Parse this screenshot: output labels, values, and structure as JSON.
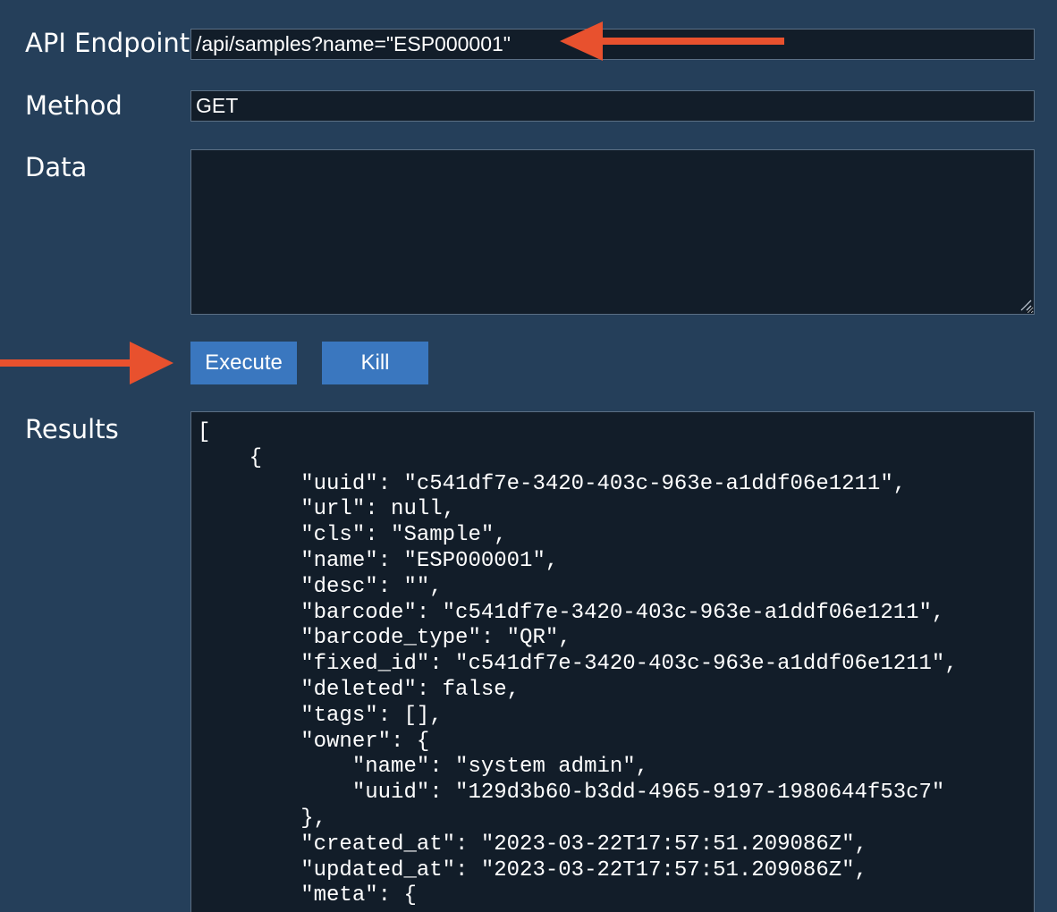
{
  "form": {
    "endpoint_label": "API Endpoint",
    "endpoint_value": "/api/samples?name=\"ESP000001\"",
    "method_label": "Method",
    "method_value": "GET",
    "data_label": "Data",
    "data_value": "",
    "results_label": "Results"
  },
  "buttons": {
    "execute_label": "Execute",
    "kill_label": "Kill"
  },
  "results": {
    "text": "[\n    {\n        \"uuid\": \"c541df7e-3420-403c-963e-a1ddf06e1211\",\n        \"url\": null,\n        \"cls\": \"Sample\",\n        \"name\": \"ESP000001\",\n        \"desc\": \"\",\n        \"barcode\": \"c541df7e-3420-403c-963e-a1ddf06e1211\",\n        \"barcode_type\": \"QR\",\n        \"fixed_id\": \"c541df7e-3420-403c-963e-a1ddf06e1211\",\n        \"deleted\": false,\n        \"tags\": [],\n        \"owner\": {\n            \"name\": \"system admin\",\n            \"uuid\": \"129d3b60-b3dd-4965-9197-1980644f53c7\"\n        },\n        \"created_at\": \"2023-03-22T17:57:51.209086Z\",\n        \"updated_at\": \"2023-03-22T17:57:51.209086Z\",\n        \"meta\": {"
  },
  "annotations": {
    "arrow_color": "#e8512e",
    "arrow_icon": "left-arrow",
    "arrow2_icon": "right-arrow"
  },
  "colors": {
    "background": "#253f5a",
    "field_background": "#121d29",
    "button": "#3a77bf"
  }
}
